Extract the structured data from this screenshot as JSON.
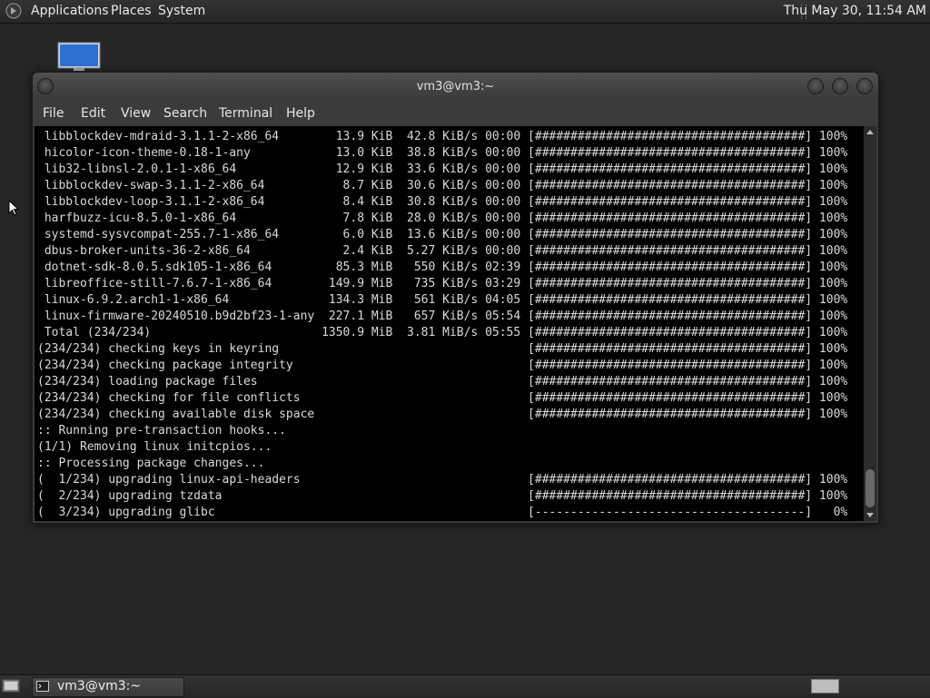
{
  "top_panel": {
    "menus": [
      "Applications",
      "Places",
      "System"
    ],
    "clock": "Thu May 30, 11:54 AM"
  },
  "window": {
    "title": "vm3@vm3:~",
    "menubar": [
      "File",
      "Edit",
      "View",
      "Search",
      "Terminal",
      "Help"
    ]
  },
  "terminal": {
    "lines": [
      " libblockdev-mdraid-3.1.1-2-x86_64        13.9 KiB  42.8 KiB/s 00:00 [######################################] 100%",
      " hicolor-icon-theme-0.18-1-any            13.0 KiB  38.8 KiB/s 00:00 [######################################] 100%",
      " lib32-libnsl-2.0.1-1-x86_64              12.9 KiB  33.6 KiB/s 00:00 [######################################] 100%",
      " libblockdev-swap-3.1.1-2-x86_64           8.7 KiB  30.6 KiB/s 00:00 [######################################] 100%",
      " libblockdev-loop-3.1.1-2-x86_64           8.4 KiB  30.8 KiB/s 00:00 [######################################] 100%",
      " harfbuzz-icu-8.5.0-1-x86_64               7.8 KiB  28.0 KiB/s 00:00 [######################################] 100%",
      " systemd-sysvcompat-255.7-1-x86_64         6.0 KiB  13.6 KiB/s 00:00 [######################################] 100%",
      " dbus-broker-units-36-2-x86_64             2.4 KiB  5.27 KiB/s 00:00 [######################################] 100%",
      " dotnet-sdk-8.0.5.sdk105-1-x86_64         85.3 MiB   550 KiB/s 02:39 [######################################] 100%",
      " libreoffice-still-7.6.7-1-x86_64        149.9 MiB   735 KiB/s 03:29 [######################################] 100%",
      " linux-6.9.2.arch1-1-x86_64              134.3 MiB   561 KiB/s 04:05 [######################################] 100%",
      " linux-firmware-20240510.b9d2bf23-1-any  227.1 MiB   657 KiB/s 05:54 [######################################] 100%",
      " Total (234/234)                        1350.9 MiB  3.81 MiB/s 05:55 [######################################] 100%",
      "(234/234) checking keys in keyring                                   [######################################] 100%",
      "(234/234) checking package integrity                                 [######################################] 100%",
      "(234/234) loading package files                                      [######################################] 100%",
      "(234/234) checking for file conflicts                                [######################################] 100%",
      "(234/234) checking available disk space                              [######################################] 100%",
      ":: Running pre-transaction hooks...",
      "(1/1) Removing linux initcpios...",
      ":: Processing package changes...",
      "(  1/234) upgrading linux-api-headers                                [######################################] 100%",
      "(  2/234) upgrading tzdata                                           [######################################] 100%",
      "(  3/234) upgrading glibc                                            [--------------------------------------]   0%"
    ]
  },
  "taskbar": {
    "task_label": "vm3@vm3:~"
  }
}
